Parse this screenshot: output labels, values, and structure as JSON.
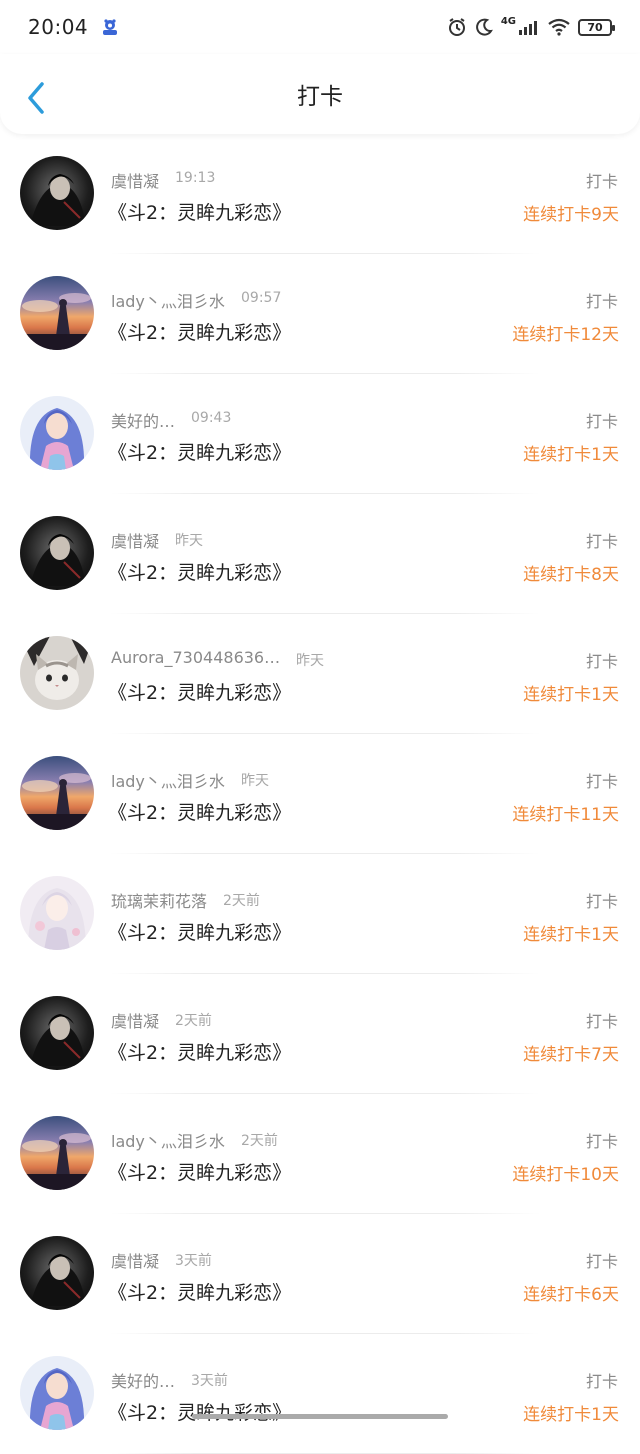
{
  "status_bar": {
    "time": "20:04",
    "network": "4G",
    "battery": "70"
  },
  "header": {
    "title": "打卡"
  },
  "checkins": [
    {
      "name": "虞惜凝",
      "time": "19:13",
      "book": "《斗2：灵眸九彩恋》",
      "action": "打卡",
      "streak": "连续打卡9天",
      "avatar": "dark-hair-icon"
    },
    {
      "name": "lady丶灬泪彡水",
      "time": "09:57",
      "book": "《斗2：灵眸九彩恋》",
      "action": "打卡",
      "streak": "连续打卡12天",
      "avatar": "sunset-icon"
    },
    {
      "name": "美好的…",
      "time": "09:43",
      "book": "《斗2：灵眸九彩恋》",
      "action": "打卡",
      "streak": "连续打卡1天",
      "avatar": "anime-blue-icon"
    },
    {
      "name": "虞惜凝",
      "time": "昨天",
      "book": "《斗2：灵眸九彩恋》",
      "action": "打卡",
      "streak": "连续打卡8天",
      "avatar": "dark-hair-icon"
    },
    {
      "name": "Aurora_730448636…",
      "time": "昨天",
      "book": "《斗2：灵眸九彩恋》",
      "action": "打卡",
      "streak": "连续打卡1天",
      "avatar": "cat-icon"
    },
    {
      "name": "lady丶灬泪彡水",
      "time": "昨天",
      "book": "《斗2：灵眸九彩恋》",
      "action": "打卡",
      "streak": "连续打卡11天",
      "avatar": "sunset-icon"
    },
    {
      "name": "琉璃茉莉花落",
      "time": "2天前",
      "book": "《斗2：灵眸九彩恋》",
      "action": "打卡",
      "streak": "连续打卡1天",
      "avatar": "anime-white-icon"
    },
    {
      "name": "虞惜凝",
      "time": "2天前",
      "book": "《斗2：灵眸九彩恋》",
      "action": "打卡",
      "streak": "连续打卡7天",
      "avatar": "dark-hair-icon"
    },
    {
      "name": "lady丶灬泪彡水",
      "time": "2天前",
      "book": "《斗2：灵眸九彩恋》",
      "action": "打卡",
      "streak": "连续打卡10天",
      "avatar": "sunset-icon"
    },
    {
      "name": "虞惜凝",
      "time": "3天前",
      "book": "《斗2：灵眸九彩恋》",
      "action": "打卡",
      "streak": "连续打卡6天",
      "avatar": "dark-hair-icon"
    },
    {
      "name": "美好的…",
      "time": "3天前",
      "book": "《斗2：灵眸九彩恋》",
      "action": "打卡",
      "streak": "连续打卡1天",
      "avatar": "anime-blue-icon"
    }
  ],
  "colors": {
    "accent_streak": "#f08a3a",
    "back_arrow": "#2d9cdb"
  }
}
